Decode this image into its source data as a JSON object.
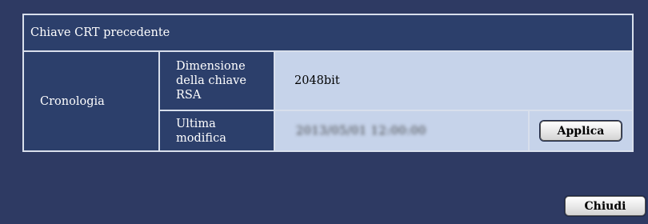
{
  "section": {
    "title": "Chiave CRT precedente"
  },
  "history": {
    "label": "Cronologia",
    "rsa_key_size_label": "Dimensione della chiave RSA",
    "rsa_key_size_value": "2048bit",
    "last_modified_label": "Ultima modifica",
    "last_modified_value": "2013/05/01 12:00:00",
    "apply_label": "Applica"
  },
  "footer": {
    "close_label": "Chiudi"
  },
  "colors": {
    "background": "#2e3a63",
    "header_cell": "#2c3f6b",
    "value_cell": "#c6d3ea"
  }
}
